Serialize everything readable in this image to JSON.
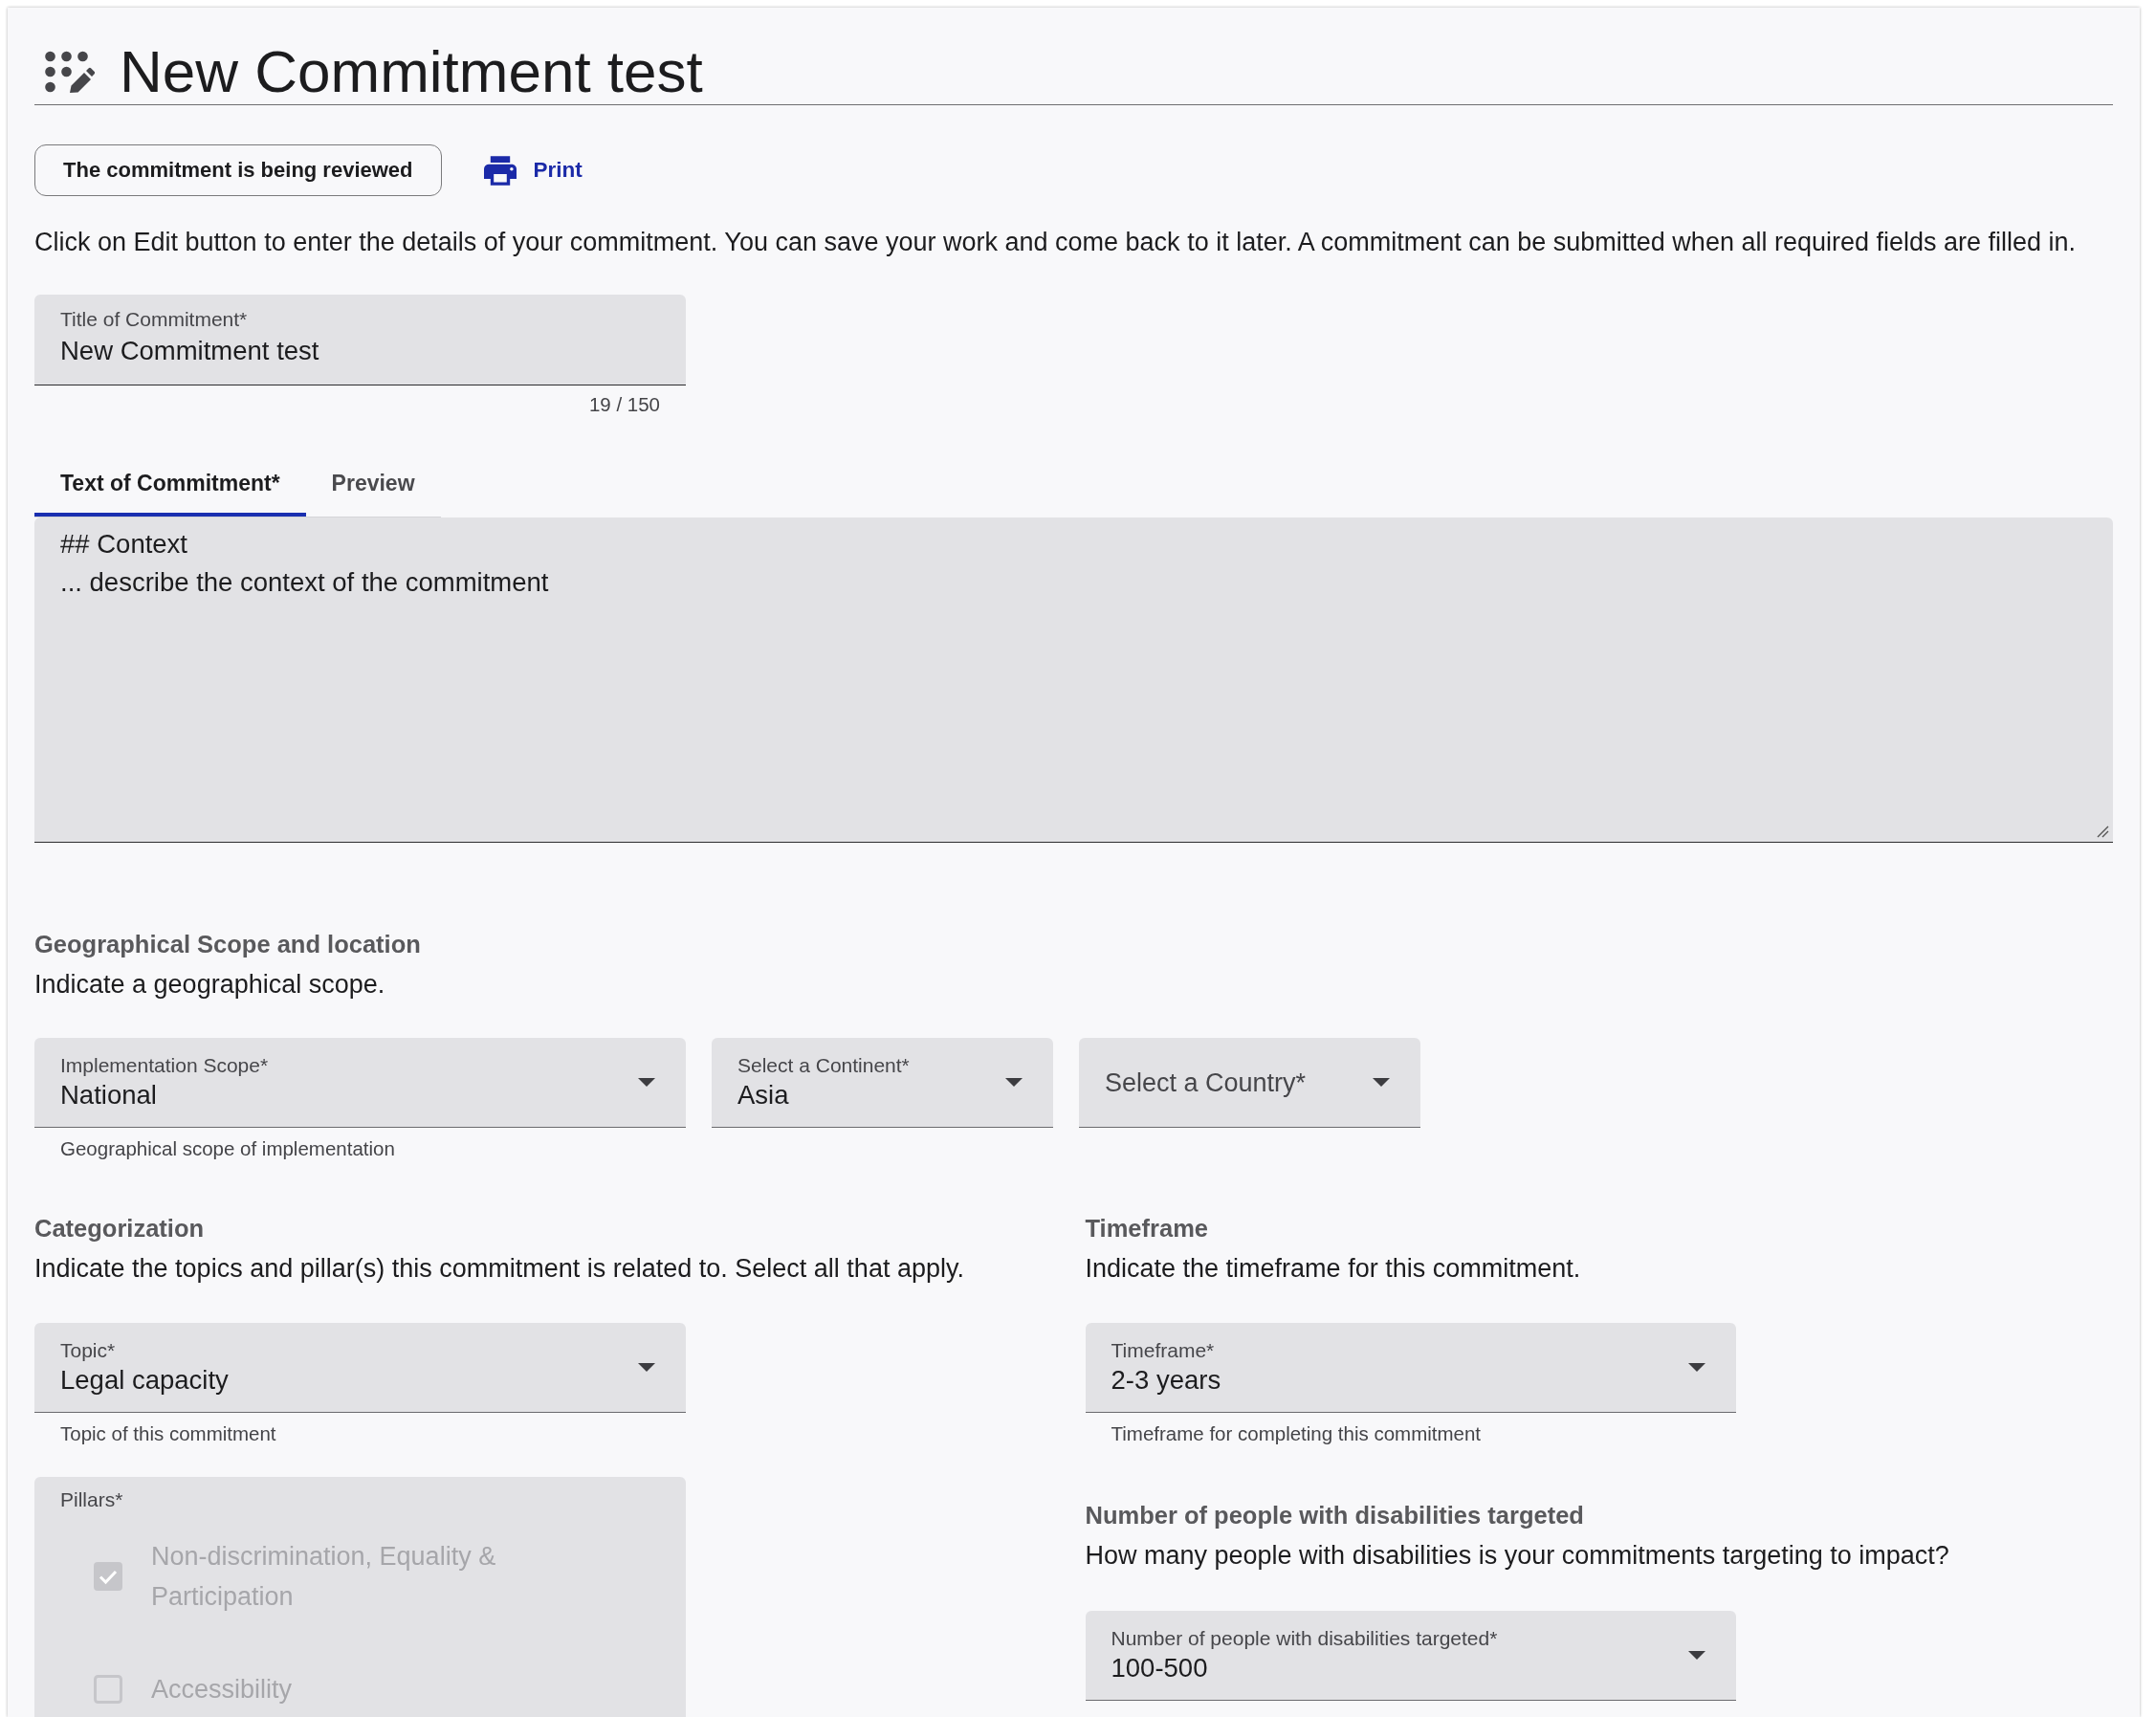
{
  "header": {
    "title": "New Commitment test"
  },
  "actions": {
    "status_button": "The commitment is being reviewed",
    "print_button": "Print"
  },
  "intro": "Click on Edit button to enter the details of your commitment. You can save your work and come back to it later. A commitment can be submitted when all required fields are filled in.",
  "title_field": {
    "label": "Title of Commitment*",
    "value": "New Commitment test",
    "counter": "19 / 150"
  },
  "editor": {
    "tabs": [
      {
        "label": "Text of Commitment*",
        "selected": true
      },
      {
        "label": "Preview",
        "selected": false
      }
    ],
    "text": "## Context\n... describe the context of the commitment"
  },
  "geography": {
    "heading": "Geographical Scope and location",
    "instruction": "Indicate a geographical scope.",
    "selects": [
      {
        "label": "Implementation Scope*",
        "value": "National",
        "helper": "Geographical scope of implementation"
      },
      {
        "label": "Select a Continent*",
        "value": "Asia"
      },
      {
        "label": "Select a Country*"
      }
    ]
  },
  "categorization": {
    "heading": "Categorization",
    "instruction": "Indicate the topics and pillar(s) this commitment is related to. Select all that apply.",
    "topic": {
      "label": "Topic*",
      "value": "Legal capacity",
      "helper": "Topic of this commitment"
    },
    "pillars": {
      "label": "Pillars*",
      "disabled": true,
      "options": [
        {
          "label": "Non-discrimination, Equality & Participation",
          "checked": true
        },
        {
          "label": "Accessibility",
          "checked": false
        }
      ]
    }
  },
  "timeframe": {
    "heading": "Timeframe",
    "instruction": "Indicate the timeframe for this commitment.",
    "select": {
      "label": "Timeframe*",
      "value": "2-3 years",
      "helper": "Timeframe for completing this commitment"
    }
  },
  "people_targeted": {
    "heading": "Number of people with disabilities targeted",
    "question": "How many people with disabilities is your commitments targeting to impact?",
    "select": {
      "label": "Number of people with disabilities targeted*",
      "value": "100-500"
    }
  }
}
